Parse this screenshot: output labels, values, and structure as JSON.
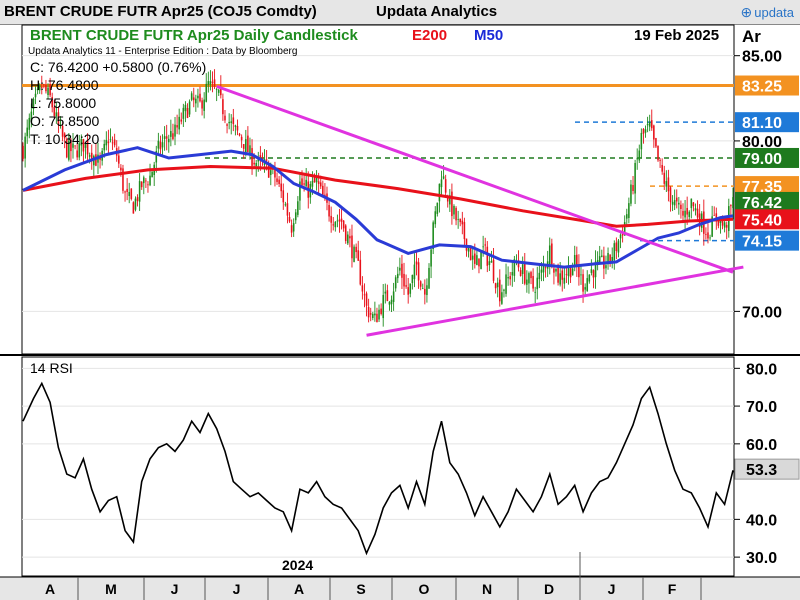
{
  "header": {
    "title": "BRENT CRUDE FUTR  Apr25 (COJ5 Comdty)",
    "brand": "Updata Analytics",
    "logo_text": "updata",
    "logo_icon": "updata-chevron-icon"
  },
  "chart_data": [
    {
      "type": "candlestick",
      "title": "BRENT CRUDE FUTR  Apr25 Daily Candlestick",
      "date": "19 Feb 2025",
      "subtitle": "Updata Analytics 11 - Enterprise Edition : Data by Bloomberg",
      "axis_unit": "Ar",
      "ohlc": {
        "close": "C: 76.4200  +0.5800 (0.76%)",
        "high": "H: 76.4800",
        "low": "L: 75.8000",
        "open": "O: 75.8500",
        "t": "T: 10.34:20"
      },
      "ylim": [
        67.5,
        86.8
      ],
      "yticks": [
        {
          "value": 85,
          "label": "85.00"
        },
        {
          "value": 80,
          "label": "80.00"
        },
        {
          "value": 70,
          "label": "70.00"
        }
      ],
      "price_tags": [
        {
          "value": 83.25,
          "label": "83.25",
          "color": "#f39221",
          "line": "solid"
        },
        {
          "value": 81.1,
          "label": "81.10",
          "color": "#1f7ad8",
          "line": "dashed"
        },
        {
          "value": 79.0,
          "label": "79.00",
          "color": "#1e7a1e",
          "line": "dashed"
        },
        {
          "value": 77.35,
          "label": "77.35",
          "color": "#f39221",
          "line": "dashed"
        },
        {
          "value": 76.42,
          "label": "76.42",
          "color": "#1e7a1e",
          "line": "none"
        },
        {
          "value": 75.4,
          "label": "75.40",
          "color": "#e8111a",
          "line": "none"
        },
        {
          "value": 74.15,
          "label": "74.15",
          "color": "#1f7ad8",
          "line": "dashed"
        }
      ],
      "legend": [
        {
          "name": "E200",
          "color": "#e8111a"
        },
        {
          "name": "M50",
          "color": "#1a2ad8"
        }
      ],
      "xlabels": [
        "A",
        "M",
        "J",
        "J",
        "A",
        "S",
        "O",
        "N",
        "D",
        "J",
        "F"
      ],
      "year_label": "2024",
      "colors": {
        "up": "#1e8c1e",
        "down": "#e8111a",
        "ema200": "#e8111a",
        "ma50": "#2a3bd6",
        "trendline": "#e033e0"
      },
      "close_path": [
        [
          0,
          79.5
        ],
        [
          5,
          82
        ],
        [
          9,
          83.2
        ],
        [
          13,
          82.5
        ],
        [
          17,
          80.8
        ],
        [
          21,
          79.5
        ],
        [
          25,
          79.4
        ],
        [
          29,
          79.8
        ],
        [
          33,
          79.3
        ],
        [
          37,
          78.6
        ],
        [
          41,
          80.2
        ],
        [
          45,
          79.2
        ],
        [
          49,
          76.8
        ],
        [
          53,
          76.2
        ],
        [
          57,
          77.4
        ],
        [
          61,
          77.9
        ],
        [
          65,
          79.5
        ],
        [
          69,
          80.2
        ],
        [
          73,
          80.5
        ],
        [
          77,
          81.5
        ],
        [
          81,
          82.3
        ],
        [
          85,
          82.1
        ],
        [
          89,
          83.3
        ],
        [
          93,
          82.8
        ],
        [
          97,
          81.6
        ],
        [
          101,
          80.7
        ],
        [
          105,
          80.2
        ],
        [
          109,
          79.2
        ],
        [
          113,
          78.6
        ],
        [
          117,
          78.5
        ],
        [
          121,
          77.9
        ],
        [
          125,
          76.6
        ],
        [
          129,
          75.0
        ],
        [
          133,
          77.5
        ],
        [
          137,
          77.1
        ],
        [
          141,
          77.6
        ],
        [
          145,
          76.3
        ],
        [
          149,
          75.5
        ],
        [
          153,
          75.3
        ],
        [
          157,
          74.0
        ],
        [
          161,
          72.6
        ],
        [
          165,
          70.2
        ],
        [
          169,
          69.5
        ],
        [
          173,
          70.6
        ],
        [
          177,
          71.1
        ],
        [
          181,
          72.5
        ],
        [
          185,
          71.0
        ],
        [
          189,
          72.7
        ],
        [
          193,
          71.1
        ],
        [
          197,
          74.8
        ],
        [
          201,
          78.2
        ],
        [
          205,
          76.3
        ],
        [
          209,
          75.1
        ],
        [
          213,
          74.1
        ],
        [
          217,
          72.6
        ],
        [
          221,
          73.6
        ],
        [
          225,
          72.7
        ],
        [
          229,
          71.1
        ],
        [
          233,
          71.9
        ],
        [
          237,
          72.9
        ],
        [
          241,
          72.1
        ],
        [
          245,
          71.4
        ],
        [
          249,
          72.2
        ],
        [
          253,
          73.6
        ],
        [
          257,
          72.0
        ],
        [
          261,
          72.3
        ],
        [
          265,
          72.8
        ],
        [
          269,
          71.6
        ],
        [
          273,
          72.4
        ],
        [
          277,
          72.7
        ],
        [
          281,
          72.9
        ],
        [
          285,
          73.8
        ],
        [
          289,
          75.2
        ],
        [
          293,
          77.5
        ],
        [
          297,
          80.2
        ],
        [
          301,
          80.8
        ],
        [
          305,
          78.8
        ],
        [
          309,
          77.3
        ],
        [
          313,
          76.3
        ],
        [
          317,
          75.6
        ],
        [
          321,
          76.4
        ],
        [
          325,
          75.5
        ],
        [
          329,
          74.6
        ],
        [
          333,
          75.6
        ],
        [
          337,
          74.9
        ],
        [
          341,
          76.4
        ]
      ],
      "ma50": [
        [
          0,
          77.1
        ],
        [
          20,
          78.3
        ],
        [
          40,
          79.2
        ],
        [
          55,
          79.6
        ],
        [
          70,
          79.0
        ],
        [
          85,
          79.2
        ],
        [
          100,
          79.4
        ],
        [
          110,
          79.2
        ],
        [
          120,
          78.5
        ],
        [
          130,
          77.5
        ],
        [
          140,
          77.0
        ],
        [
          150,
          76.4
        ],
        [
          160,
          75.4
        ],
        [
          170,
          74.2
        ],
        [
          185,
          73.4
        ],
        [
          200,
          73.9
        ],
        [
          215,
          73.8
        ],
        [
          230,
          73.0
        ],
        [
          245,
          72.8
        ],
        [
          260,
          72.6
        ],
        [
          275,
          72.8
        ],
        [
          285,
          72.9
        ],
        [
          295,
          73.6
        ],
        [
          305,
          74.3
        ],
        [
          315,
          74.6
        ],
        [
          325,
          75.1
        ],
        [
          335,
          75.5
        ],
        [
          341,
          75.6
        ]
      ],
      "ema200": [
        [
          0,
          77.1
        ],
        [
          30,
          77.8
        ],
        [
          60,
          78.3
        ],
        [
          90,
          78.5
        ],
        [
          120,
          78.4
        ],
        [
          150,
          77.7
        ],
        [
          180,
          77.2
        ],
        [
          210,
          76.6
        ],
        [
          240,
          75.9
        ],
        [
          270,
          75.3
        ],
        [
          285,
          75.0
        ],
        [
          300,
          75.1
        ],
        [
          320,
          75.3
        ],
        [
          341,
          75.4
        ]
      ],
      "trendlines": [
        {
          "name": "upper-resistance",
          "from": [
            93,
            83.2
          ],
          "to": [
            341,
            72.3
          ]
        },
        {
          "name": "lower-support",
          "from": [
            165,
            68.6
          ],
          "to": [
            346,
            72.6
          ]
        }
      ]
    },
    {
      "type": "line",
      "title": "14 RSI",
      "ylim": [
        25,
        83
      ],
      "yticks": [
        {
          "value": 80,
          "label": "80.0"
        },
        {
          "value": 70,
          "label": "70.0"
        },
        {
          "value": 60,
          "label": "60.0"
        },
        {
          "value": 40,
          "label": "40.0"
        },
        {
          "value": 30,
          "label": "30.0"
        }
      ],
      "last_value": 53.3,
      "last_label": "53.3",
      "rsi": [
        [
          0,
          66
        ],
        [
          5,
          72
        ],
        [
          9,
          76
        ],
        [
          13,
          71
        ],
        [
          17,
          59
        ],
        [
          21,
          52
        ],
        [
          25,
          51
        ],
        [
          29,
          56
        ],
        [
          33,
          48
        ],
        [
          37,
          42
        ],
        [
          41,
          45
        ],
        [
          45,
          46
        ],
        [
          49,
          37
        ],
        [
          53,
          34
        ],
        [
          57,
          50
        ],
        [
          61,
          56
        ],
        [
          65,
          59
        ],
        [
          69,
          60
        ],
        [
          73,
          58
        ],
        [
          77,
          61
        ],
        [
          81,
          66
        ],
        [
          85,
          63
        ],
        [
          89,
          68
        ],
        [
          93,
          64
        ],
        [
          97,
          58
        ],
        [
          101,
          50
        ],
        [
          105,
          48
        ],
        [
          109,
          46
        ],
        [
          113,
          47
        ],
        [
          117,
          45
        ],
        [
          121,
          43
        ],
        [
          125,
          42
        ],
        [
          129,
          37
        ],
        [
          133,
          48
        ],
        [
          137,
          47
        ],
        [
          141,
          50
        ],
        [
          145,
          46
        ],
        [
          149,
          44
        ],
        [
          153,
          43
        ],
        [
          157,
          40
        ],
        [
          161,
          37
        ],
        [
          165,
          31
        ],
        [
          169,
          36
        ],
        [
          173,
          43
        ],
        [
          177,
          47
        ],
        [
          181,
          49
        ],
        [
          185,
          43
        ],
        [
          189,
          50
        ],
        [
          193,
          44
        ],
        [
          197,
          58
        ],
        [
          201,
          66
        ],
        [
          205,
          55
        ],
        [
          209,
          52
        ],
        [
          213,
          47
        ],
        [
          217,
          41
        ],
        [
          221,
          46
        ],
        [
          225,
          42
        ],
        [
          229,
          38
        ],
        [
          233,
          42
        ],
        [
          237,
          48
        ],
        [
          241,
          45
        ],
        [
          245,
          42
        ],
        [
          249,
          46
        ],
        [
          253,
          52
        ],
        [
          257,
          44
        ],
        [
          261,
          46
        ],
        [
          265,
          49
        ],
        [
          269,
          42
        ],
        [
          273,
          47
        ],
        [
          277,
          50
        ],
        [
          281,
          51
        ],
        [
          285,
          55
        ],
        [
          289,
          60
        ],
        [
          293,
          65
        ],
        [
          297,
          72
        ],
        [
          301,
          75
        ],
        [
          305,
          68
        ],
        [
          309,
          60
        ],
        [
          313,
          53
        ],
        [
          317,
          48
        ],
        [
          321,
          47
        ],
        [
          325,
          43
        ],
        [
          329,
          38
        ],
        [
          333,
          47
        ],
        [
          337,
          44
        ],
        [
          341,
          53
        ]
      ]
    }
  ]
}
